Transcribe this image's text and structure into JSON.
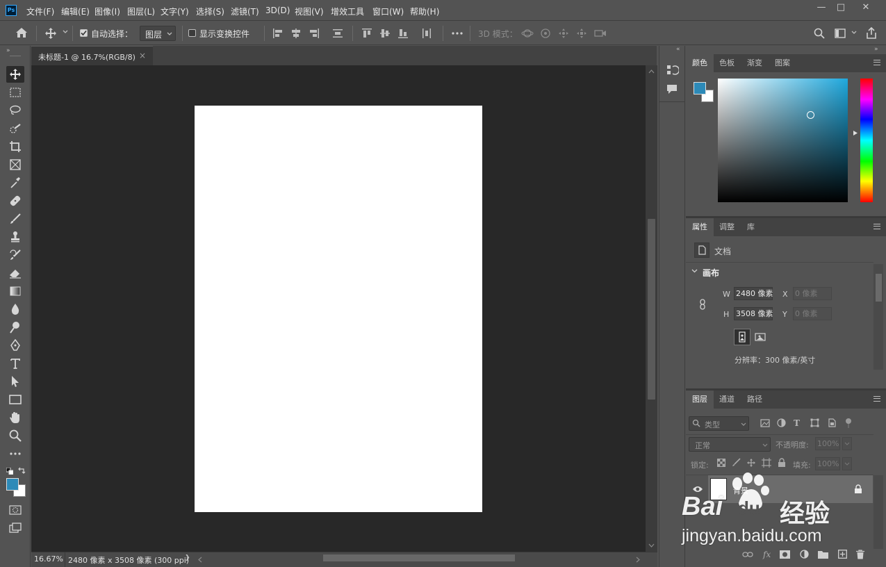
{
  "app": {
    "logo": "Ps"
  },
  "menu": [
    "文件(F)",
    "编辑(E)",
    "图像(I)",
    "图层(L)",
    "文字(Y)",
    "选择(S)",
    "滤镜(T)",
    "3D(D)",
    "视图(V)",
    "增效工具",
    "窗口(W)",
    "帮助(H)"
  ],
  "window_controls": {
    "minimize": "—",
    "maximize": "□",
    "close": "✕"
  },
  "options": {
    "auto_select_label": "自动选择：",
    "auto_select_checked": true,
    "layer_dropdown": "图层",
    "show_transform_label": "显示变换控件",
    "show_transform_checked": false,
    "mode_3d_label": "3D 模式："
  },
  "document": {
    "tab_title": "未标题-1 @ 16.7%(RGB/8)",
    "tab_close": "×",
    "zoom": "16.67%",
    "info": "2480 像素 x 3508 像素 (300 ppi)",
    "arrow": "❯"
  },
  "colors": {
    "foreground": "#2d8ab8",
    "background": "#ffffff",
    "picker_hue": "#1fa8dd"
  },
  "panels": {
    "color_tabs": [
      "颜色",
      "色板",
      "渐变",
      "图案"
    ],
    "properties_tabs": [
      "属性",
      "调整",
      "库"
    ],
    "doc_label": "文档",
    "canvas_section": "画布",
    "w_label": "W",
    "w_value": "2480 像素",
    "h_label": "H",
    "h_value": "3508 像素",
    "x_label": "X",
    "x_placeholder": "0 像素",
    "y_label": "Y",
    "y_placeholder": "0 像素",
    "resolution": "分辨率：300 像素/英寸",
    "layers_tabs": [
      "图层",
      "通道",
      "路径"
    ],
    "filter_kind": "类型",
    "blend_mode": "正常",
    "opacity_label": "不透明度:",
    "opacity_value": "100%",
    "lock_label": "锁定:",
    "fill_label": "填充:",
    "fill_value": "100%",
    "layer_name": "背景"
  },
  "watermark": {
    "logo": "Bai",
    "logo2": "du",
    "cn": "经验",
    "url": "jingyan.baidu.com"
  }
}
